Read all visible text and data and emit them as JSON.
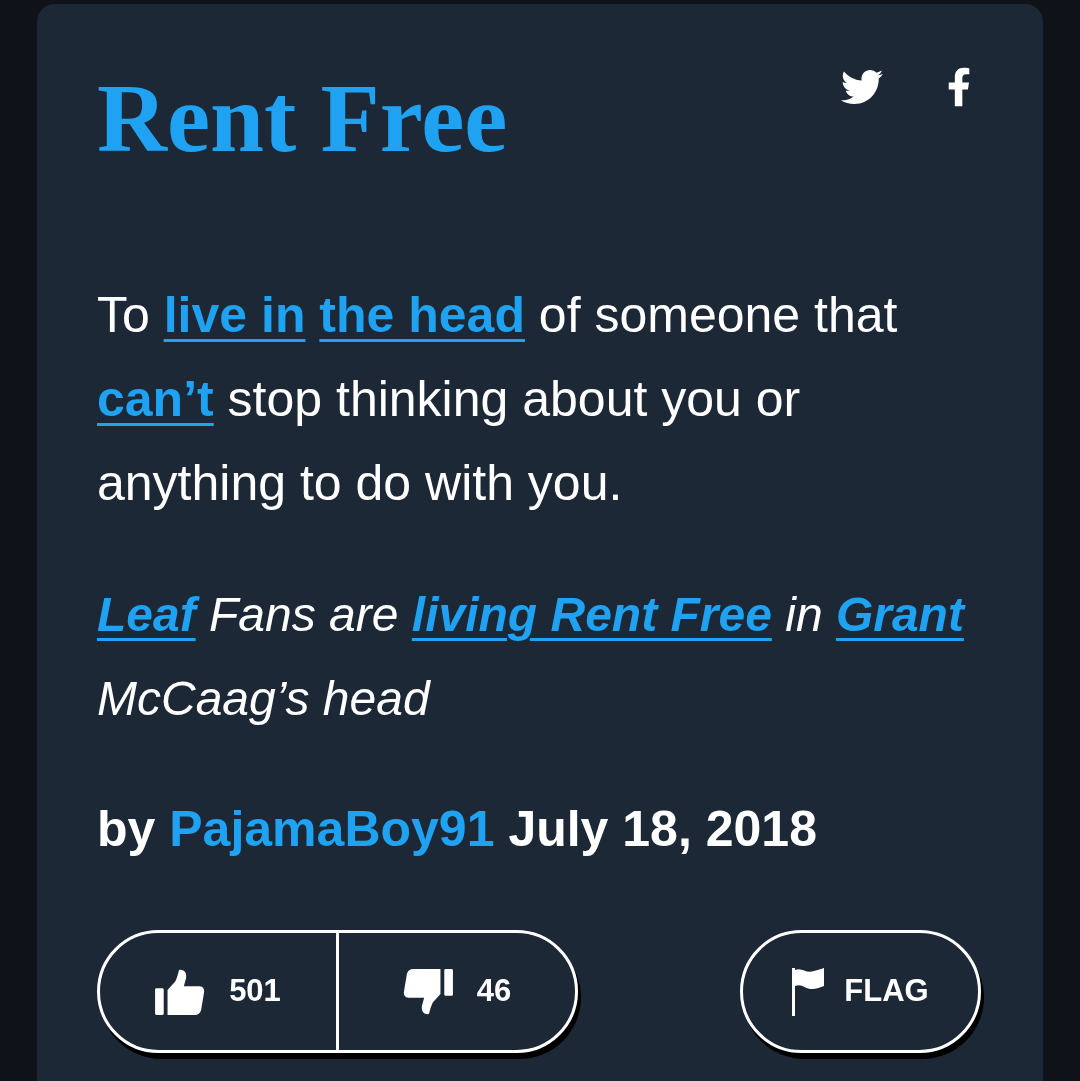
{
  "title": "Rent Free",
  "definition": [
    {
      "text": "To ",
      "link": false
    },
    {
      "text": "live in ",
      "link": true
    },
    {
      "text": "the head",
      "link": true
    },
    {
      "text": " of someone that ",
      "link": false
    },
    {
      "text": "can’t",
      "link": true
    },
    {
      "text": " stop thinking about you or anything to do with you.",
      "link": false
    }
  ],
  "example": [
    {
      "text": "Leaf",
      "link": true
    },
    {
      "text": " Fans are ",
      "link": false
    },
    {
      "text": "living Rent Free",
      "link": true
    },
    {
      "text": " in ",
      "link": false
    },
    {
      "text": "Grant",
      "link": true
    },
    {
      "text": " McCaag’s head",
      "link": false
    }
  ],
  "author": {
    "prefix": "by",
    "name": "PajamaBoy91",
    "date": "July 18, 2018"
  },
  "votes": [
    {
      "kind": "up",
      "count": "501"
    },
    {
      "kind": "down",
      "count": "46"
    }
  ],
  "flag": {
    "label": "FLAG"
  }
}
